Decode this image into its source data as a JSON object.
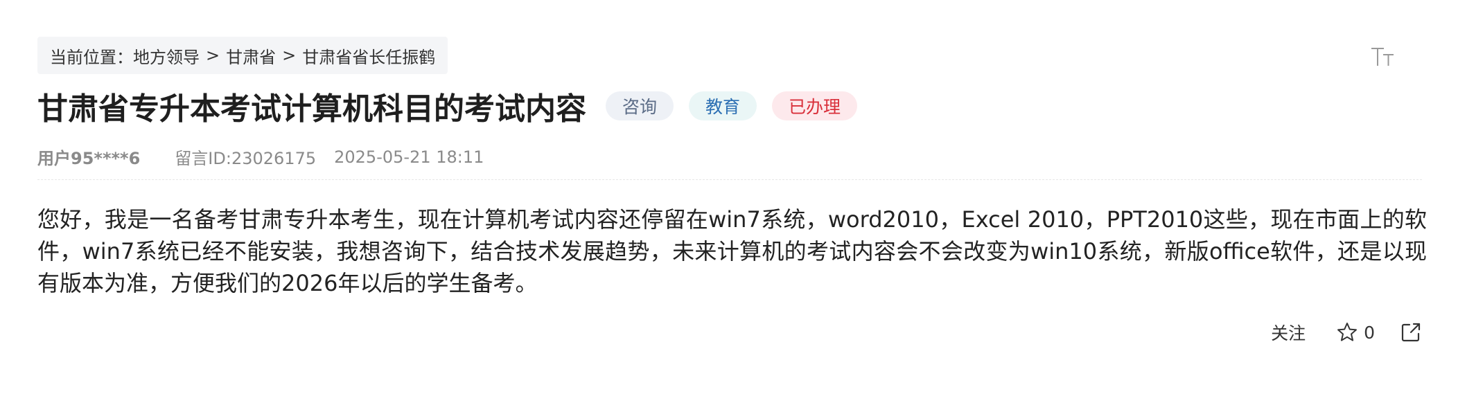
{
  "breadcrumb": {
    "label": "当前位置：",
    "items": [
      "地方领导",
      "甘肃省",
      "甘肃省省长任振鹤"
    ],
    "separator": ">"
  },
  "toolbar": {
    "font_size_icon": "font-size-icon"
  },
  "post": {
    "title": "甘肃省专升本考试计算机科目的考试内容",
    "tags": [
      {
        "label": "咨询",
        "bg": "#eef1f6",
        "color": "#5a6b86"
      },
      {
        "label": "教育",
        "bg": "#eaf6f6",
        "color": "#2c6fb3"
      },
      {
        "label": "已办理",
        "bg": "#fde9ec",
        "color": "#d9303b"
      }
    ],
    "user": "用户95****6",
    "message_id": "留言ID:23026175",
    "datetime": "2025-05-21 18:11",
    "content": "您好，我是一名备考甘肃专升本考生，现在计算机考试内容还停留在win7系统，word2010，Excel 2010，PPT2010这些，现在市面上的软件，win7系统已经不能安装，我想咨询下，结合技术发展趋势，未来计算机的考试内容会不会改变为win10系统，新版office软件，还是以现有版本为准，方便我们的2026年以后的学生备考。"
  },
  "actions": {
    "follow_label": "关注",
    "like_icon": "star-icon",
    "like_count": "0",
    "share_icon": "share-icon"
  }
}
